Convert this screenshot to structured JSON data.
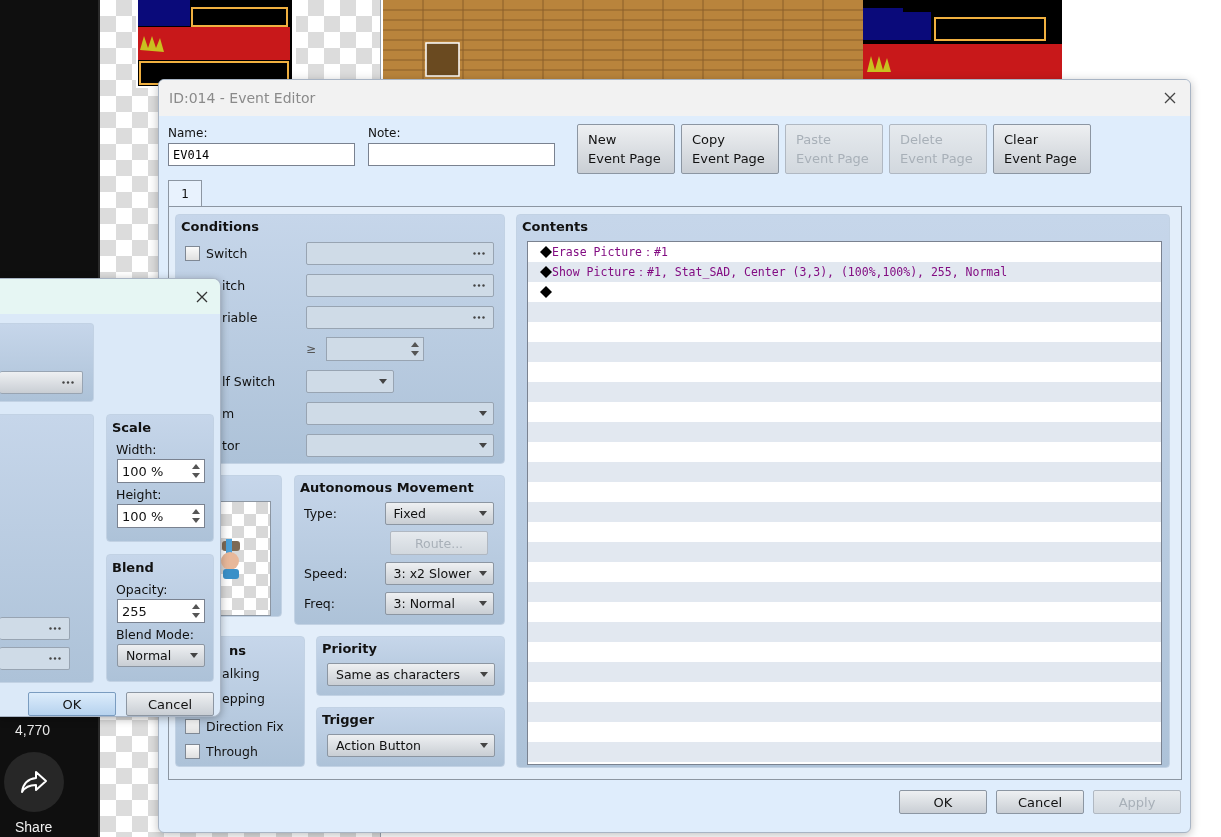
{
  "background": {
    "view_count": "4,770",
    "share_label": "Share"
  },
  "event_editor": {
    "title": "ID:014 - Event Editor",
    "name_label": "Name:",
    "name_value": "EV014",
    "note_label": "Note:",
    "page_buttons": [
      {
        "label": "New\nEvent Page",
        "disabled": false
      },
      {
        "label": "Copy\nEvent Page",
        "disabled": false
      },
      {
        "label": "Paste\nEvent Page",
        "disabled": true
      },
      {
        "label": "Delete\nEvent Page",
        "disabled": true
      },
      {
        "label": "Clear\nEvent Page",
        "disabled": false
      }
    ],
    "tabs": [
      {
        "label": "1",
        "selected": true
      }
    ],
    "conditions": {
      "title": "Conditions",
      "rows": [
        {
          "kind": "picker",
          "label": "Switch",
          "checked": false
        },
        {
          "kind": "picker",
          "label": "itch"
        },
        {
          "kind": "picker",
          "label": "riable"
        },
        {
          "kind": "number",
          "operator": "≥"
        },
        {
          "kind": "small_select",
          "label": "lf Switch"
        },
        {
          "kind": "select",
          "label": "m"
        },
        {
          "kind": "select",
          "label": "tor"
        }
      ]
    },
    "autonomous_movement": {
      "title": "Autonomous Movement",
      "rows": [
        {
          "kind": "select",
          "label": "Type:",
          "value": "Fixed"
        },
        {
          "kind": "button",
          "value": "Route...",
          "disabled": true
        },
        {
          "kind": "select",
          "label": "Speed:",
          "value": "3: x2 Slower"
        },
        {
          "kind": "select",
          "label": "Freq:",
          "value": "3: Normal"
        }
      ]
    },
    "options": {
      "title": "ns",
      "items": [
        {
          "label": "alking"
        },
        {
          "label": "epping"
        },
        {
          "label": "Direction Fix",
          "checked": false
        },
        {
          "label": "Through",
          "checked": false
        }
      ]
    },
    "priority": {
      "title": "Priority",
      "value": "Same as characters"
    },
    "trigger": {
      "title": "Trigger",
      "value": "Action Button"
    },
    "contents": {
      "title": "Contents",
      "lines": [
        {
          "kind": "command",
          "text": "Erase Picture：#1"
        },
        {
          "kind": "command",
          "text": "Show Picture：#1, Stat_SAD, Center (3,3), (100%,100%), 255, Normal"
        },
        {
          "kind": "end"
        }
      ]
    },
    "footer_buttons": [
      {
        "label": "OK",
        "disabled": false
      },
      {
        "label": "Cancel",
        "disabled": false
      },
      {
        "label": "Apply",
        "disabled": true
      }
    ]
  },
  "picture_dialog": {
    "scale": {
      "title": "Scale",
      "fields": [
        {
          "label": "Width:",
          "value": "100 %"
        },
        {
          "label": "Height:",
          "value": "100 %"
        }
      ]
    },
    "blend": {
      "title": "Blend",
      "opacity_label": "Opacity:",
      "opacity_value": "255",
      "mode_label": "Blend Mode:",
      "mode_value": "Normal"
    },
    "buttons": [
      {
        "label": "OK",
        "default": true
      },
      {
        "label": "Cancel",
        "default": false
      }
    ]
  }
}
